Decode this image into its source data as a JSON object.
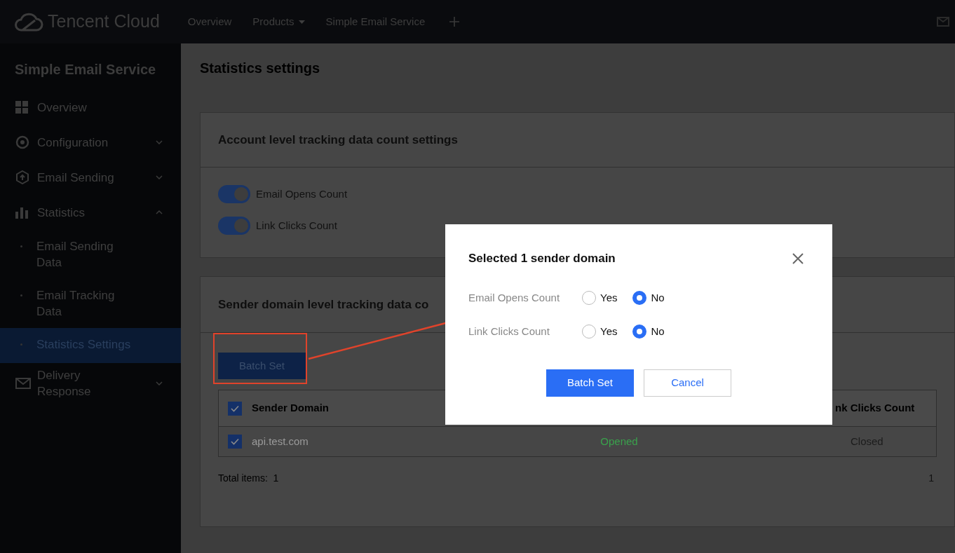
{
  "top_nav": {
    "logo": "Tencent Cloud",
    "items": [
      {
        "label": "Overview",
        "kind": "link"
      },
      {
        "label": "Products",
        "kind": "dropdown"
      },
      {
        "label": "Simple Email Service",
        "kind": "link"
      }
    ]
  },
  "sidebar": {
    "title": "Simple Email Service",
    "items": [
      {
        "label": "Overview",
        "selected": false
      },
      {
        "label": "Configuration",
        "expanded": false,
        "selected": false
      },
      {
        "label": "Email Sending",
        "expanded": false,
        "selected": false
      },
      {
        "label": "Statistics",
        "expanded": true,
        "selected": false,
        "children": [
          {
            "label": "Email Sending Data",
            "selected": false
          },
          {
            "label": "Email Tracking Data",
            "selected": false
          },
          {
            "label": "Statistics Settings",
            "selected": true
          }
        ]
      },
      {
        "label": "Delivery Response",
        "expanded": false,
        "selected": false
      }
    ]
  },
  "page_title": "Statistics settings",
  "account_card": {
    "title": "Account level tracking data count settings",
    "toggles": [
      {
        "label": "Email Opens Count",
        "on": true
      },
      {
        "label": "Link Clicks Count",
        "on": true
      }
    ]
  },
  "domain_card": {
    "title": "Sender domain level tracking data co",
    "batch_button": "Batch Set",
    "table": {
      "header_checked": true,
      "columns": [
        "Sender Domain",
        "",
        "nk Clicks Count"
      ],
      "rows": [
        {
          "checked": true,
          "cells": [
            {
              "text": "api.test.com",
              "color": "#9a9a9a"
            },
            {
              "text": "Opened",
              "color": "#3aa14c"
            },
            {
              "text": "Closed",
              "color": "#1c1c1c"
            }
          ]
        }
      ]
    },
    "total": "Total items:  1",
    "pager": "1"
  },
  "modal": {
    "title": "Selected 1 sender domain",
    "fields": [
      {
        "label": "Email Opens Count",
        "options": [
          {
            "label": "Yes",
            "selected": false
          },
          {
            "label": "No",
            "selected": true
          }
        ]
      },
      {
        "label": "Link Clicks Count",
        "options": [
          {
            "label": "Yes",
            "selected": false
          },
          {
            "label": "No",
            "selected": true
          }
        ]
      }
    ],
    "buttons": [
      {
        "label": "Batch Set",
        "kind": "primary"
      },
      {
        "label": "Cancel",
        "kind": "secondary"
      }
    ]
  }
}
